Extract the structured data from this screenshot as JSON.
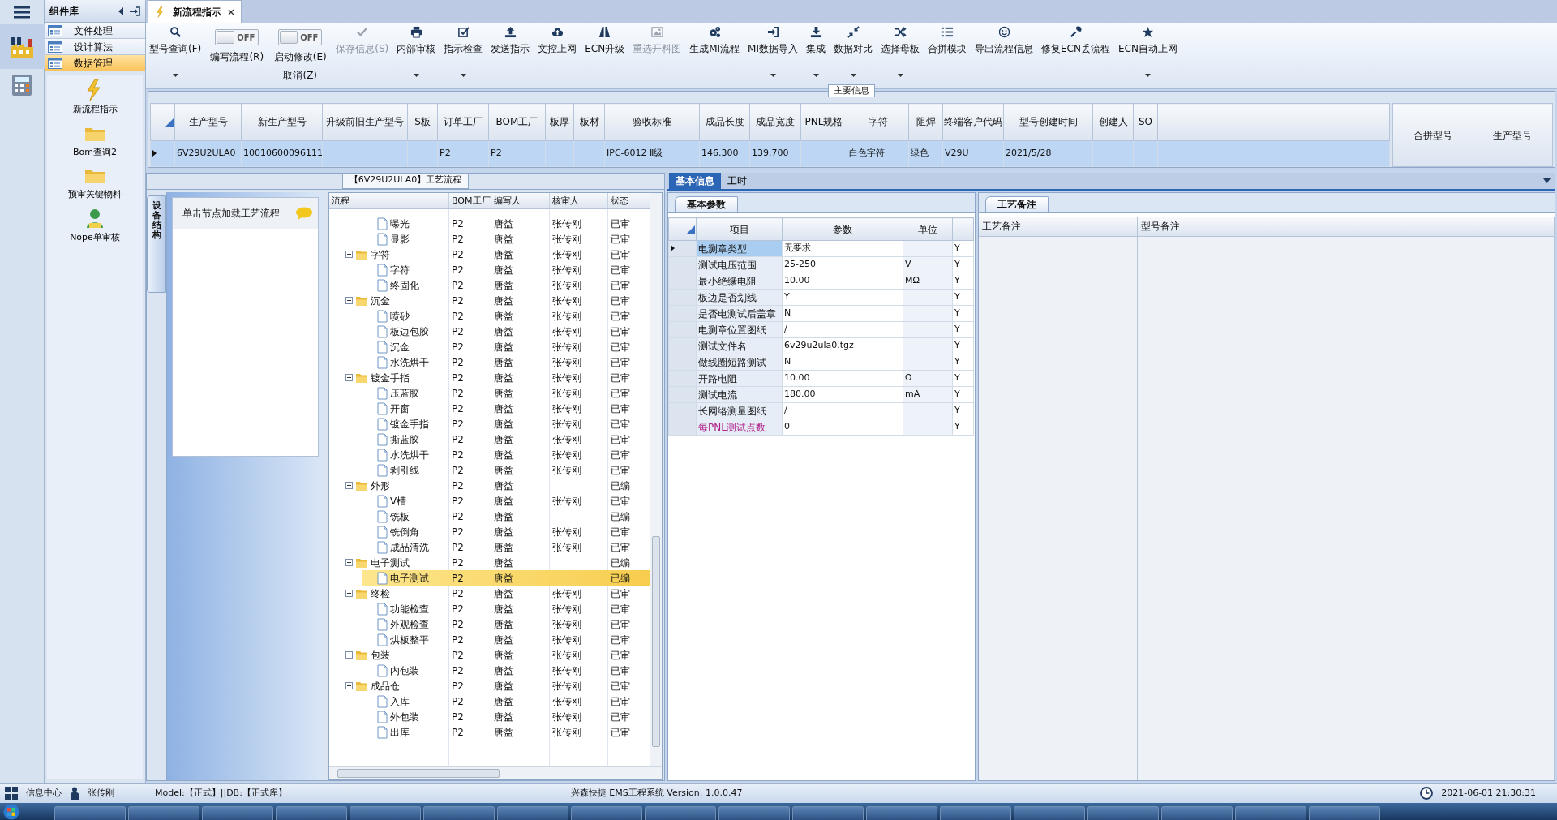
{
  "nav": {
    "title": "组件库",
    "items": [
      {
        "label": "文件处理",
        "selected": false
      },
      {
        "label": "设计算法",
        "selected": false
      },
      {
        "label": "数据管理",
        "selected": true
      }
    ],
    "tools": [
      {
        "label": "新流程指示"
      },
      {
        "label": "Bom查询2"
      },
      {
        "label": "预审关键物料"
      },
      {
        "label": "Nope单审核"
      }
    ]
  },
  "document_tab": {
    "title": "新流程指示"
  },
  "toolbar": [
    {
      "kind": "button",
      "label": "型号查询(F)",
      "disabled": false,
      "dropdown": true
    },
    {
      "kind": "toggle",
      "label": "编写流程(R)",
      "switch_text": "OFF",
      "on": false
    },
    {
      "kind": "toggle",
      "label": "启动修改(E)",
      "sublabel": "取消(Z)",
      "switch_text": "OFF",
      "on": false
    },
    {
      "kind": "button",
      "label": "保存信息(S)",
      "disabled": true,
      "dropdown": false
    },
    {
      "kind": "button",
      "label": "内部审核",
      "disabled": false,
      "dropdown": true
    },
    {
      "kind": "button",
      "label": "指示检查",
      "disabled": false,
      "dropdown": true
    },
    {
      "kind": "button",
      "label": "发送指示",
      "disabled": false,
      "dropdown": false
    },
    {
      "kind": "button",
      "label": "文控上网",
      "disabled": false,
      "dropdown": false
    },
    {
      "kind": "button",
      "label": "ECN升级",
      "disabled": false,
      "dropdown": false
    },
    {
      "kind": "button",
      "label": "重选开料图",
      "disabled": true,
      "dropdown": false
    },
    {
      "kind": "button",
      "label": "生成MI流程",
      "disabled": false,
      "dropdown": false
    },
    {
      "kind": "button",
      "label": "MI数据导入",
      "disabled": false,
      "dropdown": true
    },
    {
      "kind": "button",
      "label": "集成",
      "disabled": false,
      "dropdown": true
    },
    {
      "kind": "button",
      "label": "数据对比",
      "disabled": false,
      "dropdown": true
    },
    {
      "kind": "button",
      "label": "选择母板",
      "disabled": false,
      "dropdown": true
    },
    {
      "kind": "button",
      "label": "合拼模块",
      "disabled": false,
      "dropdown": false
    },
    {
      "kind": "button",
      "label": "导出流程信息",
      "disabled": false,
      "dropdown": false
    },
    {
      "kind": "button",
      "label": "修复ECN丢流程",
      "disabled": false,
      "dropdown": false
    },
    {
      "kind": "button",
      "label": "ECN自动上网",
      "disabled": false,
      "dropdown": true
    }
  ],
  "main_info": {
    "title": "主要信息",
    "row_selected": true,
    "columns": [
      {
        "label": "生产型号",
        "value": "6V29U2ULA0"
      },
      {
        "label": "新生产型号",
        "value": "10010600096111"
      },
      {
        "label": "升级前旧生产型号"
      },
      {
        "label": "S板"
      },
      {
        "label": "订单工厂",
        "value": "P2"
      },
      {
        "label": "BOM工厂",
        "value": "P2"
      },
      {
        "label": "板厚"
      },
      {
        "label": "板材"
      },
      {
        "label": "验收标准",
        "value": "IPC-6012 Ⅱ级"
      },
      {
        "label": "成品长度",
        "value": "146.300"
      },
      {
        "label": "成品宽度",
        "value": "139.700"
      },
      {
        "label": "PNL规格"
      },
      {
        "label": "字符",
        "value": "白色字符"
      },
      {
        "label": "阻焊",
        "value": "绿色"
      },
      {
        "label": "终端客户代码",
        "value": "V29U"
      },
      {
        "label": "型号创建时间",
        "value": "2021/5/28"
      },
      {
        "label": "创建人"
      },
      {
        "label": "SO"
      }
    ]
  },
  "merge_grid": {
    "columns": [
      "合拼型号",
      "生产型号"
    ]
  },
  "process": {
    "title": "【6V29U2ULA0】工艺流程",
    "side_tab": "设备结构",
    "hint": "单击节点加载工艺流程",
    "columns": [
      "流程",
      "BOM工厂",
      "编写人",
      "核审人",
      "状态"
    ],
    "nodes": [
      {
        "kind": "continued",
        "children": [
          {
            "label": "曝光",
            "bom": "P2",
            "author": "唐益",
            "reviewer": "张传刚",
            "status": "已审",
            "selected": false
          },
          {
            "label": "显影",
            "bom": "P2",
            "author": "唐益",
            "reviewer": "张传刚",
            "status": "已审",
            "selected": false
          }
        ]
      },
      {
        "label": "字符",
        "bom": "P2",
        "author": "唐益",
        "reviewer": "张传刚",
        "status": "已审",
        "selected": false,
        "expanded": true,
        "children": [
          {
            "label": "字符",
            "bom": "P2",
            "author": "唐益",
            "reviewer": "张传刚",
            "status": "已审",
            "selected": false
          },
          {
            "label": "终固化",
            "bom": "P2",
            "author": "唐益",
            "reviewer": "张传刚",
            "status": "已审",
            "selected": false
          }
        ]
      },
      {
        "label": "沉金",
        "bom": "P2",
        "author": "唐益",
        "reviewer": "张传刚",
        "status": "已审",
        "selected": false,
        "expanded": true,
        "children": [
          {
            "label": "喷砂",
            "bom": "P2",
            "author": "唐益",
            "reviewer": "张传刚",
            "status": "已审",
            "selected": false
          },
          {
            "label": "板边包胶",
            "bom": "P2",
            "author": "唐益",
            "reviewer": "张传刚",
            "status": "已审",
            "selected": false
          },
          {
            "label": "沉金",
            "bom": "P2",
            "author": "唐益",
            "reviewer": "张传刚",
            "status": "已审",
            "selected": false
          },
          {
            "label": "水洗烘干",
            "bom": "P2",
            "author": "唐益",
            "reviewer": "张传刚",
            "status": "已审",
            "selected": false
          }
        ]
      },
      {
        "label": "镀金手指",
        "bom": "P2",
        "author": "唐益",
        "reviewer": "张传刚",
        "status": "已审",
        "selected": false,
        "expanded": true,
        "children": [
          {
            "label": "压蓝胶",
            "bom": "P2",
            "author": "唐益",
            "reviewer": "张传刚",
            "status": "已审",
            "selected": false
          },
          {
            "label": "开窗",
            "bom": "P2",
            "author": "唐益",
            "reviewer": "张传刚",
            "status": "已审",
            "selected": false
          },
          {
            "label": "镀金手指",
            "bom": "P2",
            "author": "唐益",
            "reviewer": "张传刚",
            "status": "已审",
            "selected": false
          },
          {
            "label": "撕蓝胶",
            "bom": "P2",
            "author": "唐益",
            "reviewer": "张传刚",
            "status": "已审",
            "selected": false
          },
          {
            "label": "水洗烘干",
            "bom": "P2",
            "author": "唐益",
            "reviewer": "张传刚",
            "status": "已审",
            "selected": false
          },
          {
            "label": "剥引线",
            "bom": "P2",
            "author": "唐益",
            "reviewer": "张传刚",
            "status": "已审",
            "selected": false
          }
        ]
      },
      {
        "label": "外形",
        "bom": "P2",
        "author": "唐益",
        "status": "已编",
        "selected": false,
        "expanded": true,
        "children": [
          {
            "label": "V槽",
            "bom": "P2",
            "author": "唐益",
            "reviewer": "张传刚",
            "status": "已审",
            "selected": false
          },
          {
            "label": "铣板",
            "bom": "P2",
            "author": "唐益",
            "status": "已编",
            "selected": false
          },
          {
            "label": "铣倒角",
            "bom": "P2",
            "author": "唐益",
            "reviewer": "张传刚",
            "status": "已审",
            "selected": false
          },
          {
            "label": "成品清洗",
            "bom": "P2",
            "author": "唐益",
            "reviewer": "张传刚",
            "status": "已审",
            "selected": false
          }
        ]
      },
      {
        "label": "电子测试",
        "bom": "P2",
        "author": "唐益",
        "status": "已编",
        "selected": false,
        "expanded": true,
        "children": [
          {
            "label": "电子测试",
            "bom": "P2",
            "author": "唐益",
            "status": "已编",
            "selected": true
          }
        ]
      },
      {
        "label": "终检",
        "bom": "P2",
        "author": "唐益",
        "reviewer": "张传刚",
        "status": "已审",
        "selected": false,
        "expanded": true,
        "children": [
          {
            "label": "功能检查",
            "bom": "P2",
            "author": "唐益",
            "reviewer": "张传刚",
            "status": "已审",
            "selected": false
          },
          {
            "label": "外观检查",
            "bom": "P2",
            "author": "唐益",
            "reviewer": "张传刚",
            "status": "已审",
            "selected": false
          },
          {
            "label": "烘板整平",
            "bom": "P2",
            "author": "唐益",
            "reviewer": "张传刚",
            "status": "已审",
            "selected": false
          }
        ]
      },
      {
        "label": "包装",
        "bom": "P2",
        "author": "唐益",
        "reviewer": "张传刚",
        "status": "已审",
        "selected": false,
        "expanded": true,
        "children": [
          {
            "label": "内包装",
            "bom": "P2",
            "author": "唐益",
            "reviewer": "张传刚",
            "status": "已审",
            "selected": false
          }
        ]
      },
      {
        "label": "成品仓",
        "bom": "P2",
        "author": "唐益",
        "reviewer": "张传刚",
        "status": "已审",
        "selected": false,
        "expanded": true,
        "children": [
          {
            "label": "入库",
            "bom": "P2",
            "author": "唐益",
            "reviewer": "张传刚",
            "status": "已审",
            "selected": false
          },
          {
            "label": "外包装",
            "bom": "P2",
            "author": "唐益",
            "reviewer": "张传刚",
            "status": "已审",
            "selected": false
          },
          {
            "label": "出库",
            "bom": "P2",
            "author": "唐益",
            "reviewer": "张传刚",
            "status": "已审",
            "selected": false
          }
        ]
      }
    ]
  },
  "detail_tabs": [
    {
      "label": "基本信息",
      "selected": true
    },
    {
      "label": "工时",
      "selected": false
    }
  ],
  "params": {
    "title": "基本参数",
    "columns": [
      "项目",
      "参数",
      "单位"
    ],
    "rows": [
      {
        "item": "电测章类型",
        "value": "无要求",
        "column_4": "Y",
        "selected": true,
        "highlight": false
      },
      {
        "item": "测试电压范围",
        "value": "25-250",
        "unit": "V",
        "column_4": "Y",
        "selected": false,
        "highlight": false
      },
      {
        "item": "最小绝缘电阻",
        "value": "10.00",
        "unit": "MΩ",
        "column_4": "Y",
        "selected": false,
        "highlight": false
      },
      {
        "item": "板边是否划线",
        "value": "Y",
        "column_4": "Y",
        "selected": false,
        "highlight": false
      },
      {
        "item": "是否电测试后盖章",
        "value": "N",
        "column_4": "Y",
        "selected": false,
        "highlight": false
      },
      {
        "item": "电测章位置图纸",
        "value": "/",
        "column_4": "Y",
        "selected": false,
        "highlight": false
      },
      {
        "item": "测试文件名",
        "value": "6v29u2ula0.tgz",
        "column_4": "Y",
        "selected": false,
        "highlight": false
      },
      {
        "item": "做线圈短路测试",
        "value": "N",
        "column_4": "Y",
        "selected": false,
        "highlight": false
      },
      {
        "item": "开路电阻",
        "value": "10.00",
        "unit": "Ω",
        "column_4": "Y",
        "selected": false,
        "highlight": false
      },
      {
        "item": "测试电流",
        "value": "180.00",
        "unit": "mA",
        "column_4": "Y",
        "selected": false,
        "highlight": false
      },
      {
        "item": "长网络测量图纸",
        "value": "/",
        "column_4": "Y",
        "selected": false,
        "highlight": false
      },
      {
        "item": "每PNL测试点数",
        "value": "0",
        "column_4": "Y",
        "selected": false,
        "highlight": true
      }
    ]
  },
  "notes": {
    "title": "工艺备注",
    "columns": [
      "工艺备注",
      "型号备注"
    ]
  },
  "status_bar": {
    "info_center": "信息中心",
    "user": "张传刚",
    "model": "Model:【正式】||DB:【正式库】",
    "system": "兴森快捷 EMS工程系统 Version: 1.0.0.47",
    "clock": "2021-06-01 21:30:31"
  }
}
